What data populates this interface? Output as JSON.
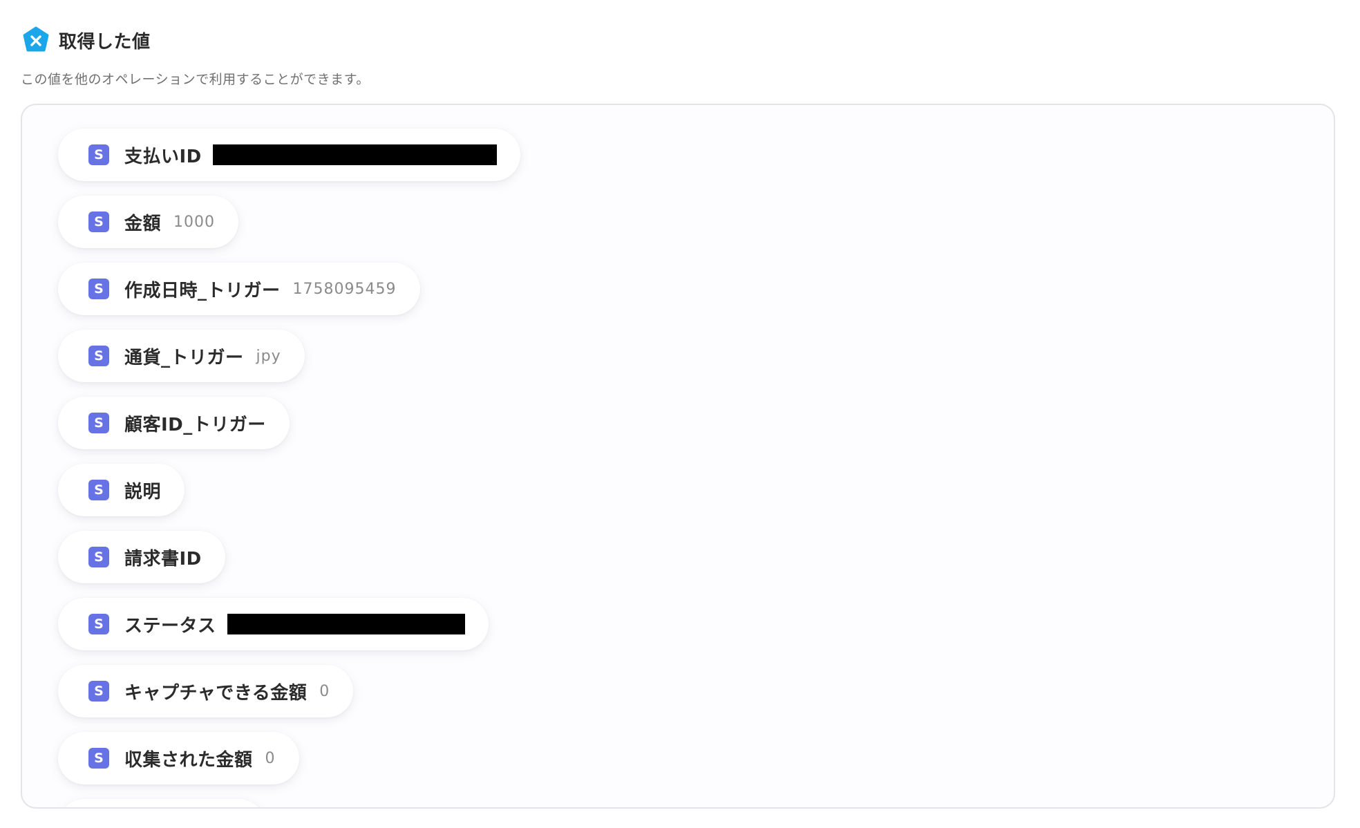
{
  "header": {
    "title": "取得した値",
    "description": "この値を他のオペレーションで利用することができます。",
    "icon": "yoom-x-logo-icon",
    "icon_color": "#1aa6e8"
  },
  "service_icon": {
    "letter": "S",
    "name": "stripe-icon",
    "color": "#6772e5"
  },
  "fields": [
    {
      "label": "支払いID",
      "value": "",
      "redacted": true
    },
    {
      "label": "金額",
      "value": "1000",
      "redacted": false
    },
    {
      "label": "作成日時_トリガー",
      "value": "1758095459",
      "redacted": false
    },
    {
      "label": "通貨_トリガー",
      "value": "jpy",
      "redacted": false
    },
    {
      "label": "顧客ID_トリガー",
      "value": "",
      "redacted": false
    },
    {
      "label": "説明",
      "value": "",
      "redacted": false
    },
    {
      "label": "請求書ID",
      "value": "",
      "redacted": false
    },
    {
      "label": "ステータス",
      "value": "",
      "redacted": true
    },
    {
      "label": "キャプチャできる金額",
      "value": "0",
      "redacted": false
    },
    {
      "label": "収集された金額",
      "value": "0",
      "redacted": false
    }
  ]
}
